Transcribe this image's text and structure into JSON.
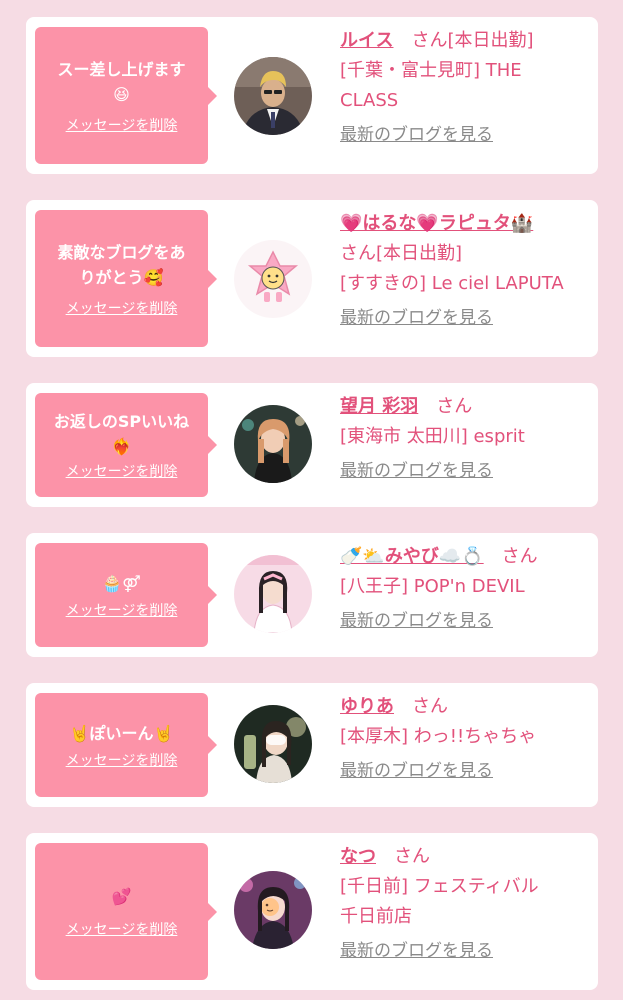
{
  "items": [
    {
      "message": "スー差し上げます",
      "emoji": "😆",
      "delete_label": "メッセージを削除",
      "name": "ルイス",
      "san": "さん",
      "status": "[本日出勤]",
      "shop_line1": "[千葉・富士見町] THE",
      "shop_line2": "CLASS",
      "blog_label": "最新のブログを見る"
    },
    {
      "message_line1": "素敵なブログをあ",
      "message_line2": "りがとう",
      "emoji": "🥰",
      "delete_label": "メッセージを削除",
      "name": "💗はるな💗ラピュタ🏰",
      "san": "さん",
      "status": "[本日出勤]",
      "shop_line1": "[すすきの] Le ciel LAPUTA",
      "blog_label": "最新のブログを見る"
    },
    {
      "message": "お返しのSPいいね",
      "emoji": "❤️‍🔥",
      "delete_label": "メッセージを削除",
      "name": "望月 彩羽",
      "san": "さん",
      "shop_line1": "[東海市 太田川] esprit",
      "blog_label": "最新のブログを見る"
    },
    {
      "message": "🧁⚤",
      "delete_label": "メッセージを削除",
      "name": "🍼⛅みやび☁️💍",
      "san": "さん",
      "shop_line1": "[八王子] POP'n DEVIL",
      "blog_label": "最新のブログを見る"
    },
    {
      "message": "🤘ぽいーん🤘",
      "delete_label": "メッセージを削除",
      "name": "ゆりあ",
      "san": "さん",
      "shop_line1": "[本厚木] わっ!!ちゃちゃ",
      "blog_label": "最新のブログを見る"
    },
    {
      "message": "💕",
      "delete_label": "メッセージを削除",
      "name": "なつ",
      "san": "さん",
      "shop_line1": "[千日前] フェスティバル",
      "shop_line2": "千日前店",
      "blog_label": "最新のブログを見る"
    }
  ],
  "colors": {
    "page_bg": "#f6dce4",
    "bubble": "#fc93a8",
    "accent_text": "#e2517b",
    "link_gray": "#8a8a8a"
  }
}
